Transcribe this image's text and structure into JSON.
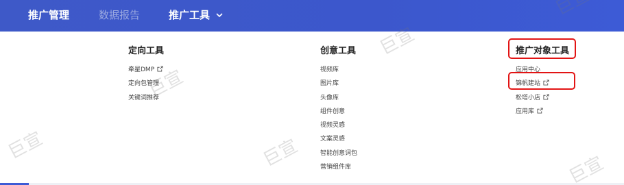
{
  "nav": {
    "items": [
      {
        "label": "推广管理"
      },
      {
        "label": "数据报告"
      },
      {
        "label": "推广工具"
      }
    ]
  },
  "columns": [
    {
      "title": "定向工具",
      "items": [
        {
          "label": "牵星DMP",
          "external": true
        },
        {
          "label": "定向包管理",
          "external": false
        },
        {
          "label": "关键词推荐",
          "external": false
        }
      ]
    },
    {
      "title": "创意工具",
      "items": [
        {
          "label": "视频库"
        },
        {
          "label": "图片库"
        },
        {
          "label": "头像库"
        },
        {
          "label": "组件创意"
        },
        {
          "label": "视频灵感"
        },
        {
          "label": "文案灵感"
        },
        {
          "label": "智能创意词包"
        },
        {
          "label": "营销组件库"
        }
      ]
    },
    {
      "title": "推广对象工具",
      "items": [
        {
          "label": "应用中心",
          "external": false
        },
        {
          "label": "锦帆建站",
          "external": true
        },
        {
          "label": "松塔小店",
          "external": true
        },
        {
          "label": "应用库",
          "external": true
        }
      ]
    }
  ],
  "watermark": {
    "text": "巨宣"
  },
  "colors": {
    "nav_bg": "#3d59cc",
    "highlight": "#e21414"
  }
}
